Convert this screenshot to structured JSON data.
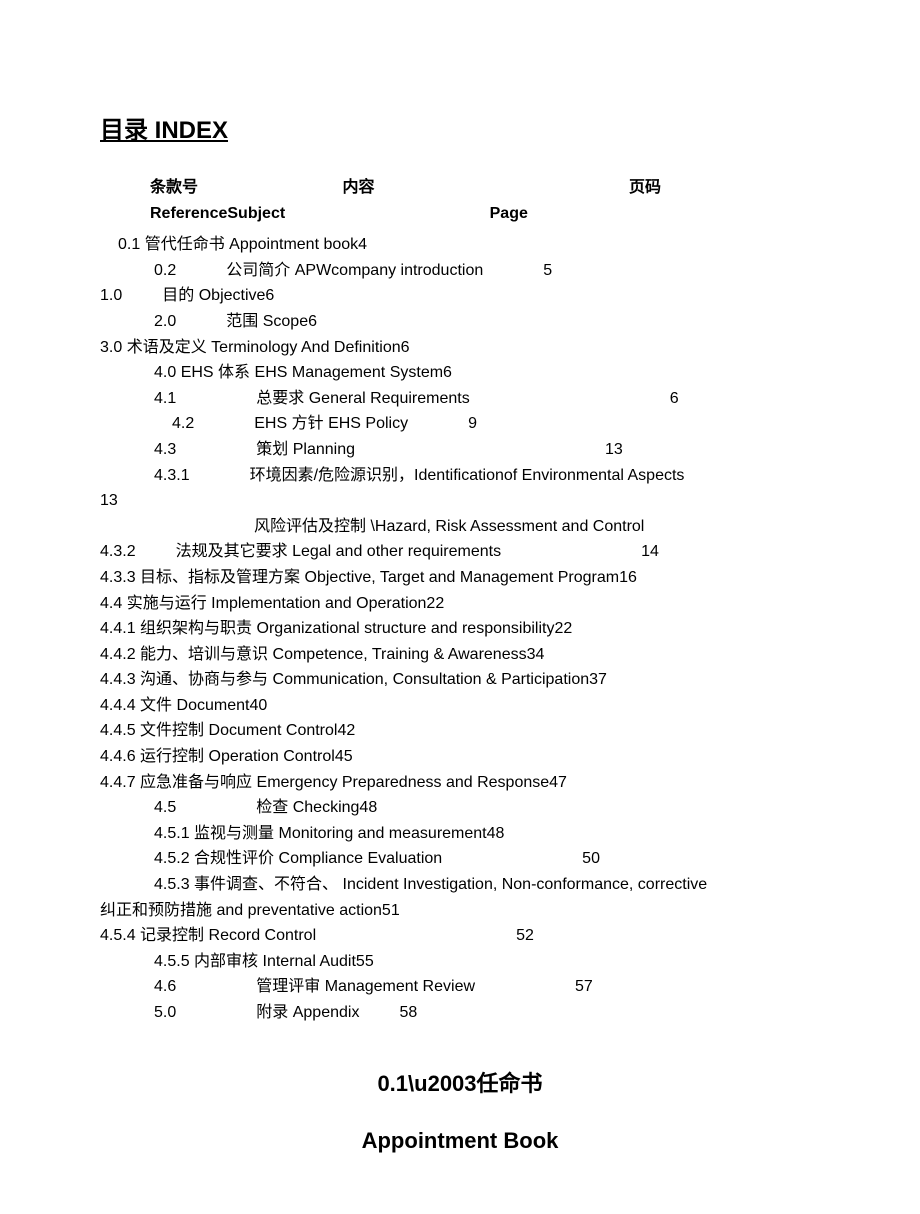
{
  "title": "目录 INDEX",
  "header": {
    "col1_cn": "条款号",
    "col2_cn": "内容",
    "col3_cn": "页码",
    "col1_en": "Reference",
    "col2_en": "Subject",
    "col3_en": "Page"
  },
  "entries": [
    {
      "indent": "indent1",
      "num": "0.1",
      "cn": "管代任命书",
      "en": "Appointment book",
      "page": "4",
      "numGap": "",
      "txtGap": "",
      "pageGap": ""
    },
    {
      "indent": "indent2",
      "num": "0.2",
      "cn": "公司简介",
      "en": "APWcompany introduction",
      "page": "5",
      "numGap": "gap50",
      "txtGap": "",
      "pageGap": "gap60"
    },
    {
      "indent": "indent0",
      "num": "1.0",
      "cn": "目的",
      "en": "Objective",
      "page": "6",
      "numGap": "gap40",
      "txtGap": "",
      "pageGap": ""
    },
    {
      "indent": "indent2",
      "num": "2.0",
      "cn": "范围",
      "en": "Scope",
      "page": "6",
      "numGap": "gap50",
      "txtGap": "",
      "pageGap": ""
    },
    {
      "indent": "indent0",
      "num": "3.0",
      "cn": "术语及定义",
      "en": "Terminology And Definition",
      "page": "6",
      "numGap": "",
      "txtGap": "",
      "pageGap": ""
    },
    {
      "indent": "indent2",
      "num": "4.0",
      "cn": "EHS 体系",
      "en": "EHS Management System",
      "page": "6",
      "numGap": "",
      "txtGap": "",
      "pageGap": ""
    },
    {
      "indent": "indent2",
      "num": "4.1",
      "cn": "总要求",
      "en": "General Requirements",
      "page": "6",
      "numGap": "gap80",
      "txtGap": "",
      "pageGap": "gap200"
    },
    {
      "indent": "indent4",
      "num": "4.2",
      "cn": "EHS 方针",
      "en": "EHS Policy",
      "page": "9",
      "numGap": "gap60",
      "txtGap": "",
      "pageGap": "gap60"
    },
    {
      "indent": "indent2",
      "num": "4.3",
      "cn": "策划",
      "en": "Planning",
      "page": "13",
      "numGap": "gap80",
      "txtGap": "",
      "pageGap": "gap250"
    },
    {
      "indent": "indent2",
      "num": "4.3.1",
      "cn": "环境因素/危险源识别，",
      "en": "Identificationof Environmental Aspects",
      "page": "13",
      "numGap": "gap60",
      "txtGap": "",
      "pageGap": "",
      "pageWrap": true
    },
    {
      "indent": "indent2",
      "num": "",
      "cn": "风险评估及控制",
      "en": "\\Hazard, Risk Assessment and Control",
      "page": "",
      "numGap": "gap100",
      "txtGap": "",
      "pageGap": ""
    },
    {
      "indent": "indent0",
      "num": "4.3.2",
      "cn": "法规及其它要求",
      "en": "Legal and other requirements",
      "page": "14",
      "numGap": "gap40",
      "txtGap": "",
      "pageGap": "gap140"
    },
    {
      "indent": "indent0",
      "num": "4.3.3",
      "cn": "目标、指标及管理方案",
      "en": "Objective, Target and Management Program",
      "page": "16",
      "numGap": "",
      "txtGap": "",
      "pageGap": ""
    },
    {
      "indent": "indent0",
      "num": "4.4",
      "cn": "实施与运行",
      "en": "Implementation and Operation",
      "page": "22",
      "numGap": "",
      "txtGap": "",
      "pageGap": ""
    },
    {
      "indent": "indent0",
      "num": "4.4.1",
      "cn": "组织架构与职责",
      "en": "Organizational structure and responsibility",
      "page": "22",
      "numGap": "",
      "txtGap": "",
      "pageGap": ""
    },
    {
      "indent": "indent0",
      "num": "4.4.2",
      "cn": "能力、培训与意识",
      "en": "Competence, Training & Awareness",
      "page": "34",
      "numGap": "",
      "txtGap": "",
      "pageGap": ""
    },
    {
      "indent": "indent0",
      "num": "4.4.3",
      "cn": "沟通、协商与参与",
      "en": "Communication, Consultation & Participation",
      "page": "37",
      "numGap": "",
      "txtGap": "",
      "pageGap": ""
    },
    {
      "indent": "indent0",
      "num": "4.4.4",
      "cn": "文件",
      "en": "Document",
      "page": "40",
      "numGap": "",
      "txtGap": "",
      "pageGap": ""
    },
    {
      "indent": "indent0",
      "num": "4.4.5",
      "cn": "文件控制",
      "en": "Document Control",
      "page": "42",
      "numGap": "",
      "txtGap": "",
      "pageGap": ""
    },
    {
      "indent": "indent0",
      "num": "4.4.6",
      "cn": "运行控制",
      "en": "Operation Control",
      "page": "45",
      "numGap": "",
      "txtGap": "",
      "pageGap": ""
    },
    {
      "indent": "indent0",
      "num": "4.4.7",
      "cn": "应急准备与响应",
      "en": "Emergency Preparedness and Response",
      "page": "47",
      "numGap": "",
      "txtGap": "",
      "pageGap": ""
    },
    {
      "indent": "indent2",
      "num": "4.5",
      "cn": "检查",
      "en": "Checking",
      "page": "48",
      "numGap": "gap80",
      "txtGap": "",
      "pageGap": ""
    },
    {
      "indent": "indent2",
      "num": "4.5.1",
      "cn": "监视与测量",
      "en": "Monitoring and measurement",
      "page": "48",
      "numGap": "",
      "txtGap": "",
      "pageGap": ""
    },
    {
      "indent": "indent2",
      "num": "4.5.2",
      "cn": "合规性评价",
      "en": "Compliance Evaluation",
      "page": "50",
      "numGap": "",
      "txtGap": "",
      "pageGap": "gap140"
    },
    {
      "indent": "indent2",
      "num": "4.5.3",
      "cn": "事件调查、不符合、",
      "en": "Incident Investigation, Non-conformance, corrective",
      "page": "",
      "numGap": "",
      "txtGap": "",
      "pageGap": ""
    },
    {
      "indent": "indent0",
      "num": "",
      "cn": "纠正和预防措施",
      "en": "and preventative action",
      "page": "51",
      "numGap": "",
      "txtGap": "",
      "pageGap": ""
    },
    {
      "indent": "indent0",
      "num": "4.5.4",
      "cn": "记录控制",
      "en": "Record Control",
      "page": "52",
      "numGap": "",
      "txtGap": "",
      "pageGap": "gap200"
    },
    {
      "indent": "indent2",
      "num": "4.5.5",
      "cn": "内部审核",
      "en": "Internal Audit",
      "page": "55",
      "numGap": "",
      "txtGap": "",
      "pageGap": ""
    },
    {
      "indent": "indent2",
      "num": "4.6",
      "cn": "管理评审",
      "en": "Management Review",
      "page": "57",
      "numGap": "gap80",
      "txtGap": "",
      "pageGap": "gap100"
    },
    {
      "indent": "indent2",
      "num": "5.0",
      "cn": "附录",
      "en": "Appendix",
      "page": "58",
      "numGap": "gap80",
      "txtGap": "",
      "pageGap": "gap40"
    }
  ],
  "section": {
    "num": "0.1",
    "cn": "任命书",
    "en": "Appointment Book"
  }
}
